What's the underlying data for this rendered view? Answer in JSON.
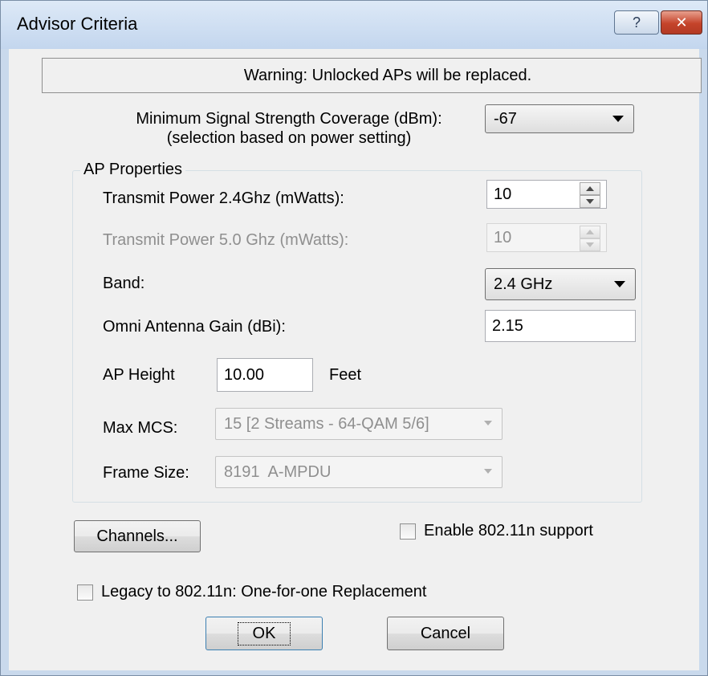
{
  "window": {
    "title": "Advisor Criteria",
    "help_glyph": "?",
    "close_glyph": "✕"
  },
  "warning": "Warning:  Unlocked APs will be replaced.",
  "min_signal": {
    "label_line1": "Minimum Signal Strength Coverage (dBm):",
    "label_line2": "(selection based on power setting)",
    "value": "-67"
  },
  "ap_properties": {
    "title": "AP Properties",
    "tx_power_24": {
      "label": "Transmit Power 2.4Ghz (mWatts):",
      "value": "10"
    },
    "tx_power_50": {
      "label": "Transmit Power 5.0 Ghz (mWatts):",
      "value": "10"
    },
    "band": {
      "label": "Band:",
      "value": "2.4 GHz"
    },
    "omni_gain": {
      "label": "Omni Antenna Gain (dBi):",
      "value": "2.15"
    },
    "ap_height": {
      "label": "AP Height",
      "value": "10.00",
      "unit": "Feet"
    },
    "max_mcs": {
      "label": "Max MCS:",
      "value": "15 [2 Streams - 64-QAM 5/6]"
    },
    "frame_size": {
      "label": "Frame Size:",
      "value": "8191  A-MPDU"
    }
  },
  "channels_button": "Channels...",
  "enable_80211n": {
    "label": "Enable 802.11n support",
    "checked": false
  },
  "legacy_replacement": {
    "label": "Legacy to 802.11n: One-for-one Replacement",
    "checked": false
  },
  "ok_button": "OK",
  "cancel_button": "Cancel",
  "colors": {
    "dialog_bg": "#f0f0f0",
    "frame": "#c9d9ec",
    "close_button": "#c5432a",
    "disabled_text": "#8f8f8f"
  }
}
